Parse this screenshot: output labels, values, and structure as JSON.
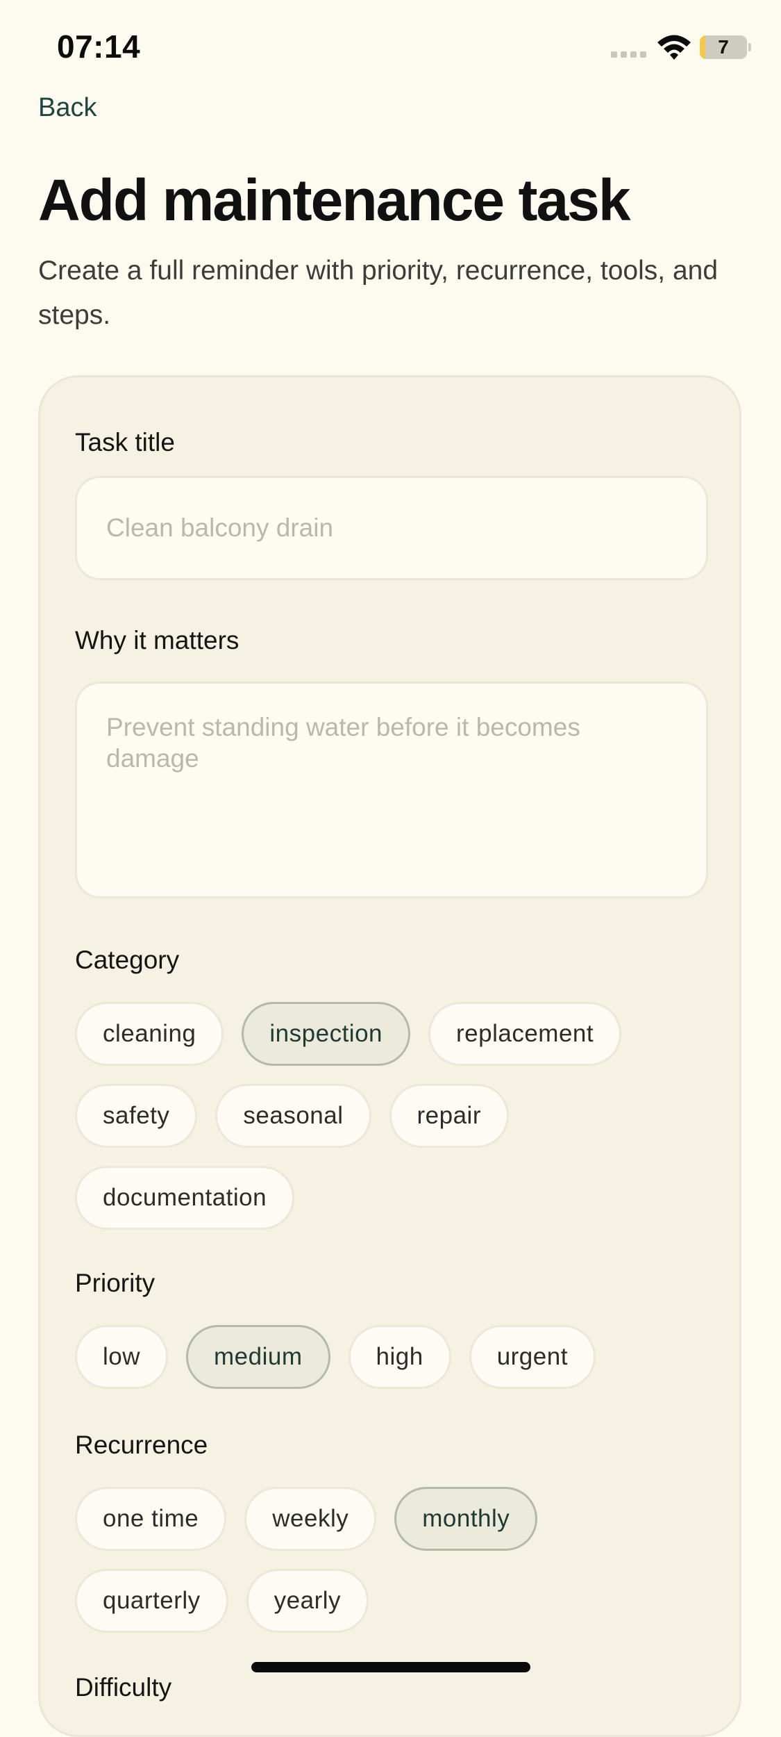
{
  "status_bar": {
    "time": "07:14",
    "battery_level": "7",
    "battery_fraction": 0.12
  },
  "nav": {
    "back_label": "Back"
  },
  "header": {
    "title": "Add maintenance task",
    "subtitle": "Create a full reminder with priority, recurrence, tools, and steps."
  },
  "form": {
    "task_title": {
      "label": "Task title",
      "value": "",
      "placeholder": "Clean balcony drain"
    },
    "why_it_matters": {
      "label": "Why it matters",
      "value": "",
      "placeholder": "Prevent standing water before it becomes damage"
    },
    "category": {
      "label": "Category",
      "options": [
        "cleaning",
        "inspection",
        "replacement",
        "safety",
        "seasonal",
        "repair",
        "documentation"
      ],
      "selected": "inspection"
    },
    "priority": {
      "label": "Priority",
      "options": [
        "low",
        "medium",
        "high",
        "urgent"
      ],
      "selected": "medium"
    },
    "recurrence": {
      "label": "Recurrence",
      "options": [
        "one time",
        "weekly",
        "monthly",
        "quarterly",
        "yearly"
      ],
      "selected": "monthly"
    },
    "difficulty": {
      "label": "Difficulty"
    }
  },
  "colors": {
    "background": "#fdfaf0",
    "card": "#f5f1e3",
    "accent": "#1f4540",
    "chip_selected_bg": "#ebeadb",
    "chip_selected_border": "#b4bba5"
  }
}
